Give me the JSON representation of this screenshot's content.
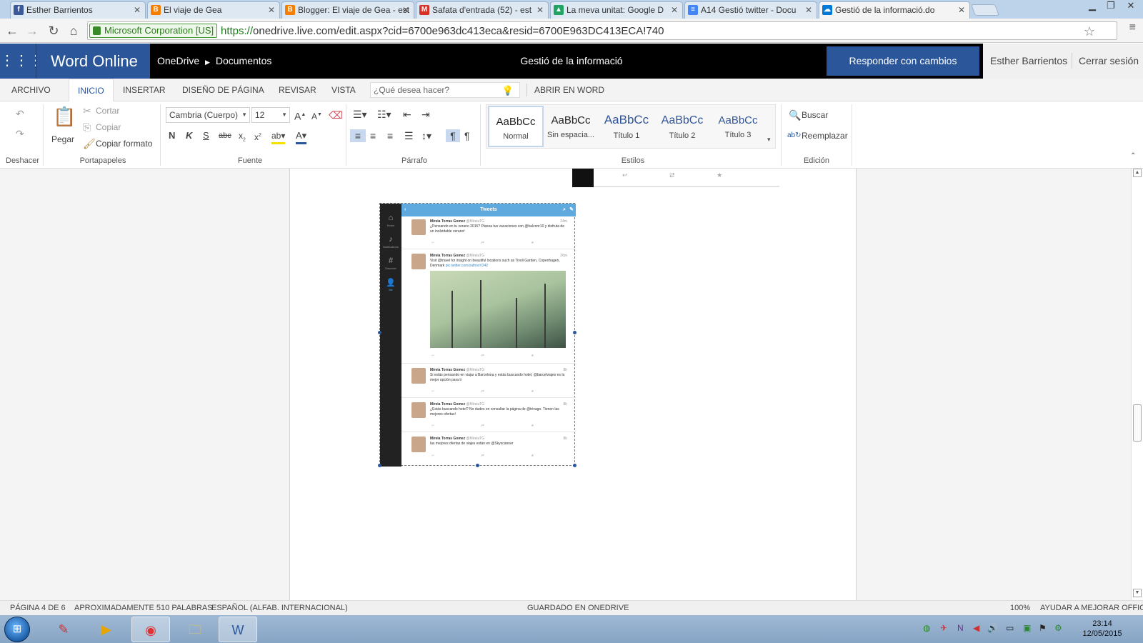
{
  "browser": {
    "tabs": [
      {
        "title": "Esther Barrientos",
        "icon": "facebook-icon",
        "color": "#3b5998",
        "glyph": "f"
      },
      {
        "title": "El viaje de Gea",
        "icon": "blogger-icon",
        "color": "#f57d00",
        "glyph": "B"
      },
      {
        "title": "Blogger: El viaje de Gea - est",
        "icon": "blogger-icon",
        "color": "#f57d00",
        "glyph": "B"
      },
      {
        "title": "Safata d'entrada (52) - est",
        "icon": "gmail-icon",
        "color": "#d93025",
        "glyph": "M"
      },
      {
        "title": "La meva unitat: Google D",
        "icon": "google-drive-icon",
        "color": "#1fa463",
        "glyph": "▲"
      },
      {
        "title": "A14 Gestió twitter - Docu",
        "icon": "google-docs-icon",
        "color": "#4285f4",
        "glyph": "≡"
      },
      {
        "title": "Gestió de la informació.do",
        "icon": "onedrive-icon",
        "color": "#0078d7",
        "glyph": "☁"
      }
    ],
    "cert": "Microsoft Corporation [US]",
    "url_proto": "https://",
    "url_rest": "onedrive.live.com/edit.aspx?cid=6700e963dc413eca&resid=6700E963DC413ECA!740"
  },
  "header": {
    "brand": "Word Online",
    "crumb1": "OneDrive",
    "crumb2": "Documentos",
    "doc_title": "Gestió de la informació",
    "reply_button": "Responder con cambios",
    "user": "Esther Barrientos",
    "signout": "Cerrar sesión"
  },
  "ribbon_tabs": {
    "archivo": "ARCHIVO",
    "inicio": "INICIO",
    "insertar": "INSERTAR",
    "diseno": "DISEÑO DE PÁGINA",
    "revisar": "REVISAR",
    "vista": "VISTA",
    "search_placeholder": "¿Qué desea hacer?",
    "open_in_word": "ABRIR EN WORD"
  },
  "ribbon": {
    "undo_group": "Deshacer",
    "paste": "Pegar",
    "cut": "Cortar",
    "copy": "Copiar",
    "format_painter": "Copiar formato",
    "clipboard_group": "Portapapeles",
    "font_name": "Cambria (Cuerpo)",
    "font_size": "12",
    "font_group": "Fuente",
    "paragraph_group": "Párrafo",
    "styles": [
      {
        "sample": "AaBbCc",
        "name": "Normal",
        "color": "#222"
      },
      {
        "sample": "AaBbCc",
        "name": "Sin espacia...",
        "color": "#222"
      },
      {
        "sample": "AaBbCc",
        "name": "Título 1",
        "color": "#2f5597"
      },
      {
        "sample": "AaBbCc",
        "name": "Título 2",
        "color": "#2f5597"
      },
      {
        "sample": "AaBbCc",
        "name": "Título 3",
        "color": "#2f5597"
      }
    ],
    "styles_group": "Estilos",
    "find": "Buscar",
    "replace": "Reemplazar",
    "editing_group": "Edición"
  },
  "twitter_shot": {
    "bar_title": "Tweets",
    "side_labels": [
      "Home",
      "Notifications",
      "Discover",
      "Me"
    ],
    "tweets": [
      {
        "name": "Mireia Torras Gomez",
        "handle": "@MireiaTG",
        "time": "24m",
        "text": "¿Pensando en tu verano 2015? Planea tus vacaciones con @halconr10 y disfruta de un inolvidable verano!",
        "link": ""
      },
      {
        "name": "Mireia Torras Gomez",
        "handle": "@MireiaTG",
        "time": "26m",
        "text": "Visit @travel for insight on beautiful locations such as Tivoli Garden, Copenhagen, Denmark",
        "link": "pic.twitter.com/zathoxV242"
      },
      {
        "name": "Mireia Torras Gomez",
        "handle": "@MireiaTG",
        "time": "8h",
        "text": "Si estás pensando en viajar a Barcelona y estás buscando hotel, @barcelviajes es la mejor opción para ti",
        "link": ""
      },
      {
        "name": "Mireia Torras Gomez",
        "handle": "@MireiaTG",
        "time": "8h",
        "text": "¿Estás buscando hotel? No dudes en consultar la página de @trivago. Tienen las mejores ofertas!",
        "link": ""
      },
      {
        "name": "Mireia Torras Gomez",
        "handle": "@MireiaTG",
        "time": "8h",
        "text": "las mejores ofertas de viajes están en @Skyscanner",
        "link": ""
      }
    ]
  },
  "status": {
    "page": "PÁGINA 4 DE 6",
    "words": "APROXIMADAMENTE 510 PALABRAS",
    "language": "ESPAÑOL (ALFAB. INTERNACIONAL)",
    "saved": "GUARDADO EN ONEDRIVE",
    "zoom": "100%",
    "help": "AYUDAR A MEJORAR OFFICE"
  },
  "taskbar": {
    "time": "23:14",
    "date": "12/05/2015"
  },
  "colors": {
    "word_blue": "#2b579a",
    "header_black": "#000000",
    "twitter_blue": "#5ea9dd"
  }
}
